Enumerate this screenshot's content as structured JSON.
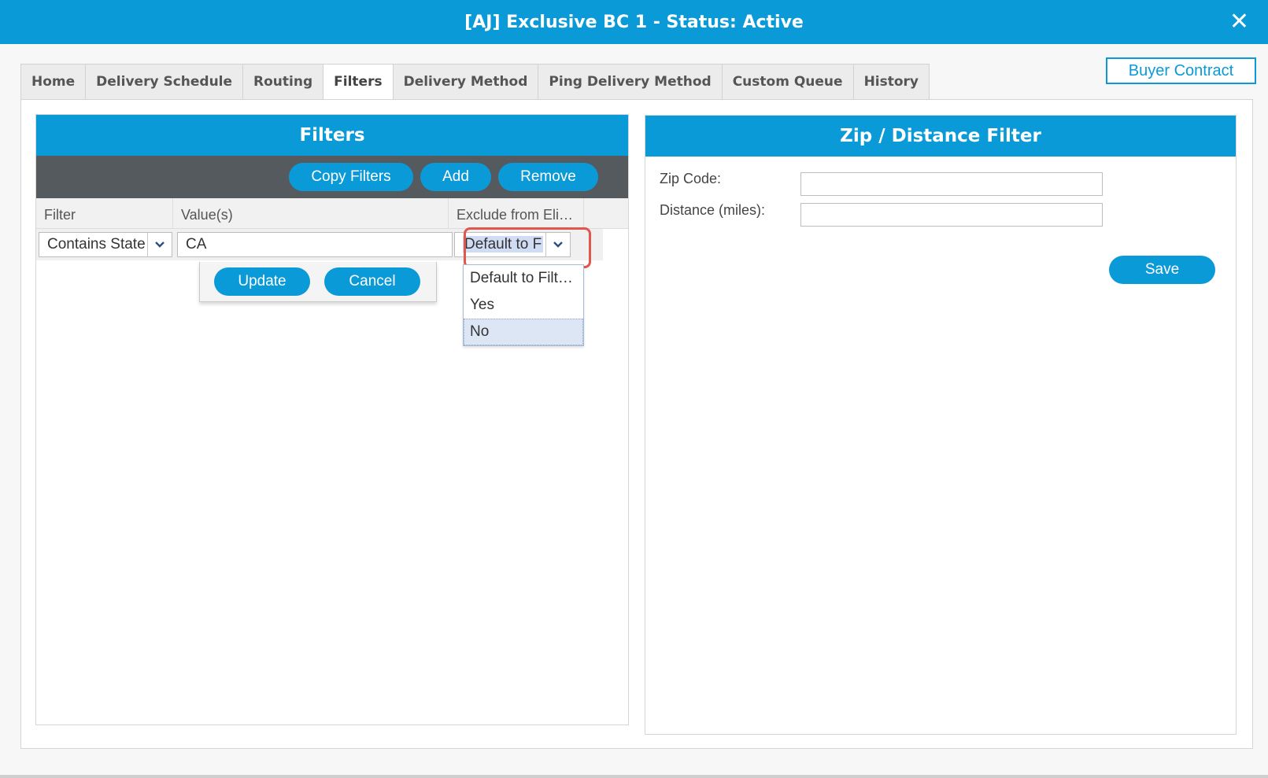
{
  "window": {
    "title": "[AJ] Exclusive BC 1 - Status: Active",
    "close_label": "✕"
  },
  "tabs": [
    {
      "label": "Home"
    },
    {
      "label": "Delivery Schedule"
    },
    {
      "label": "Routing"
    },
    {
      "label": "Filters",
      "active": true
    },
    {
      "label": "Delivery Method"
    },
    {
      "label": "Ping Delivery Method"
    },
    {
      "label": "Custom Queue"
    },
    {
      "label": "History"
    }
  ],
  "buyer_contract_label": "Buyer Contract",
  "filters_panel": {
    "title": "Filters",
    "toolbar": {
      "copy_label": "Copy Filters",
      "add_label": "Add",
      "remove_label": "Remove"
    },
    "columns": [
      "Filter",
      "Value(s)",
      "Exclude from Eli…"
    ],
    "edit_row": {
      "filter_value": "Contains State",
      "values_value": "CA",
      "exclude_value": "Default to F"
    },
    "row_editor": {
      "update_label": "Update",
      "cancel_label": "Cancel"
    },
    "exclude_options": [
      "Default to Filt…",
      "Yes",
      "No"
    ],
    "exclude_hovered": "No"
  },
  "zip_panel": {
    "title": "Zip / Distance Filter",
    "zip_label": "Zip Code:",
    "zip_value": "",
    "distance_label": "Distance (miles):",
    "distance_value": "",
    "save_label": "Save"
  },
  "colors": {
    "accent": "#0b9ad8",
    "toolbar": "#555a5e",
    "highlight": "#e0574c"
  }
}
